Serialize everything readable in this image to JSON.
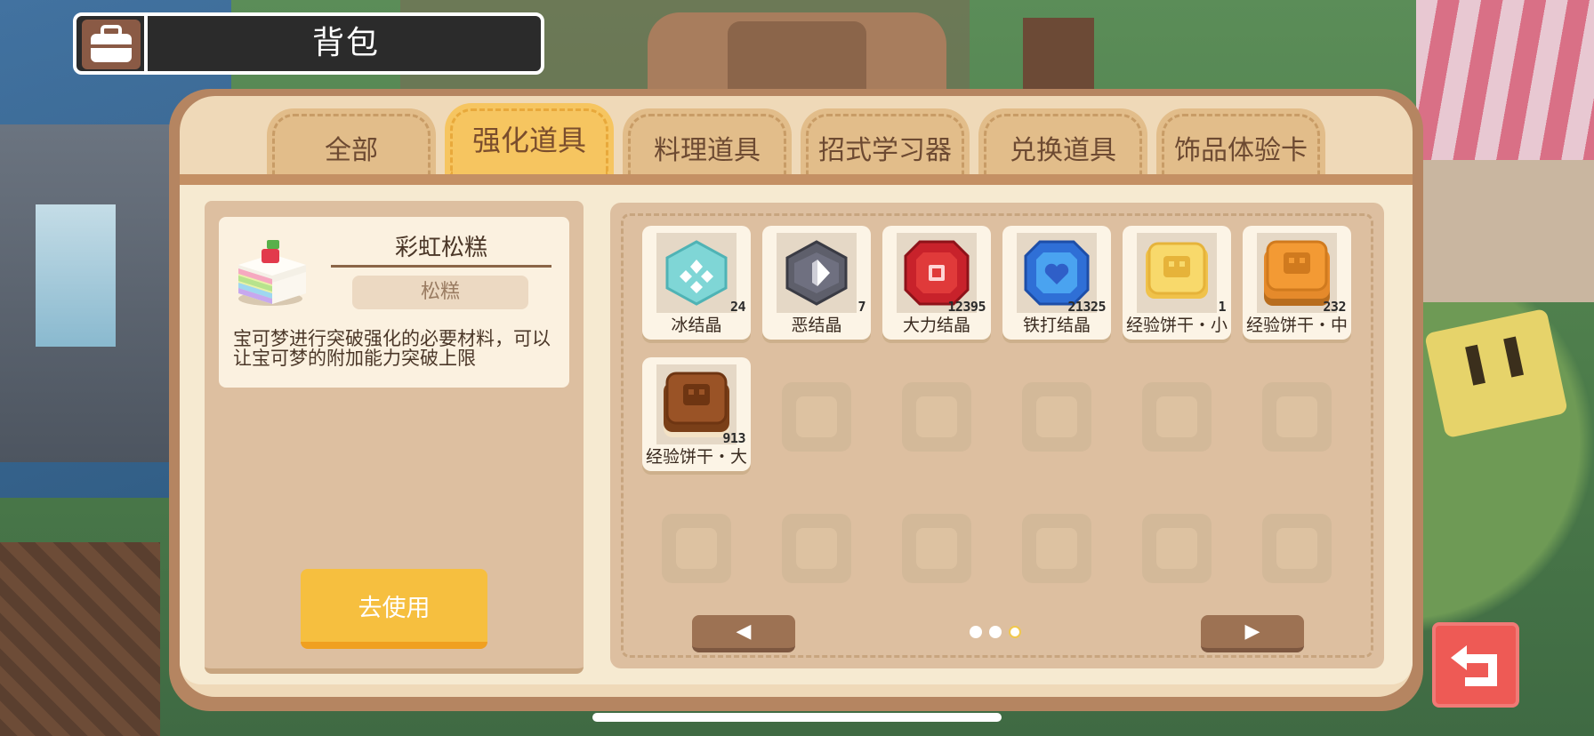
{
  "header": {
    "title": "背包",
    "icon": "bag-icon"
  },
  "tabs": [
    {
      "label": "全部",
      "active": false
    },
    {
      "label": "强化道具",
      "active": true
    },
    {
      "label": "料理道具",
      "active": false
    },
    {
      "label": "招式学习器",
      "active": false
    },
    {
      "label": "兑换道具",
      "active": false
    },
    {
      "label": "饰品体验卡",
      "active": false
    }
  ],
  "detail": {
    "name": "彩虹松糕",
    "category": "松糕",
    "description": "宝可梦进行突破强化的必要材料，可以让宝可梦的附加能力突破上限",
    "use_button": "去使用",
    "icon": "rainbow-cake-icon"
  },
  "items": [
    {
      "name": "冰结晶",
      "count": "24",
      "icon": "ice-crystal-icon"
    },
    {
      "name": "恶结晶",
      "count": "7",
      "icon": "dark-crystal-icon"
    },
    {
      "name": "大力结晶",
      "count": "12395",
      "icon": "power-crystal-icon"
    },
    {
      "name": "铁打结晶",
      "count": "21325",
      "icon": "steel-crystal-icon"
    },
    {
      "name": "经验饼干・小",
      "count": "1",
      "icon": "exp-cookie-small-icon"
    },
    {
      "name": "经验饼干・中",
      "count": "232",
      "icon": "exp-cookie-medium-icon"
    },
    {
      "name": "经验饼干・大",
      "count": "913",
      "icon": "exp-cookie-large-icon"
    }
  ],
  "pagination": {
    "prev": "◀",
    "next": "▶",
    "pages": 3,
    "current": 3
  },
  "colors": {
    "active_tab": "#f6c560",
    "use_button": "#f6bf3f",
    "back_button": "#ee5a55"
  }
}
